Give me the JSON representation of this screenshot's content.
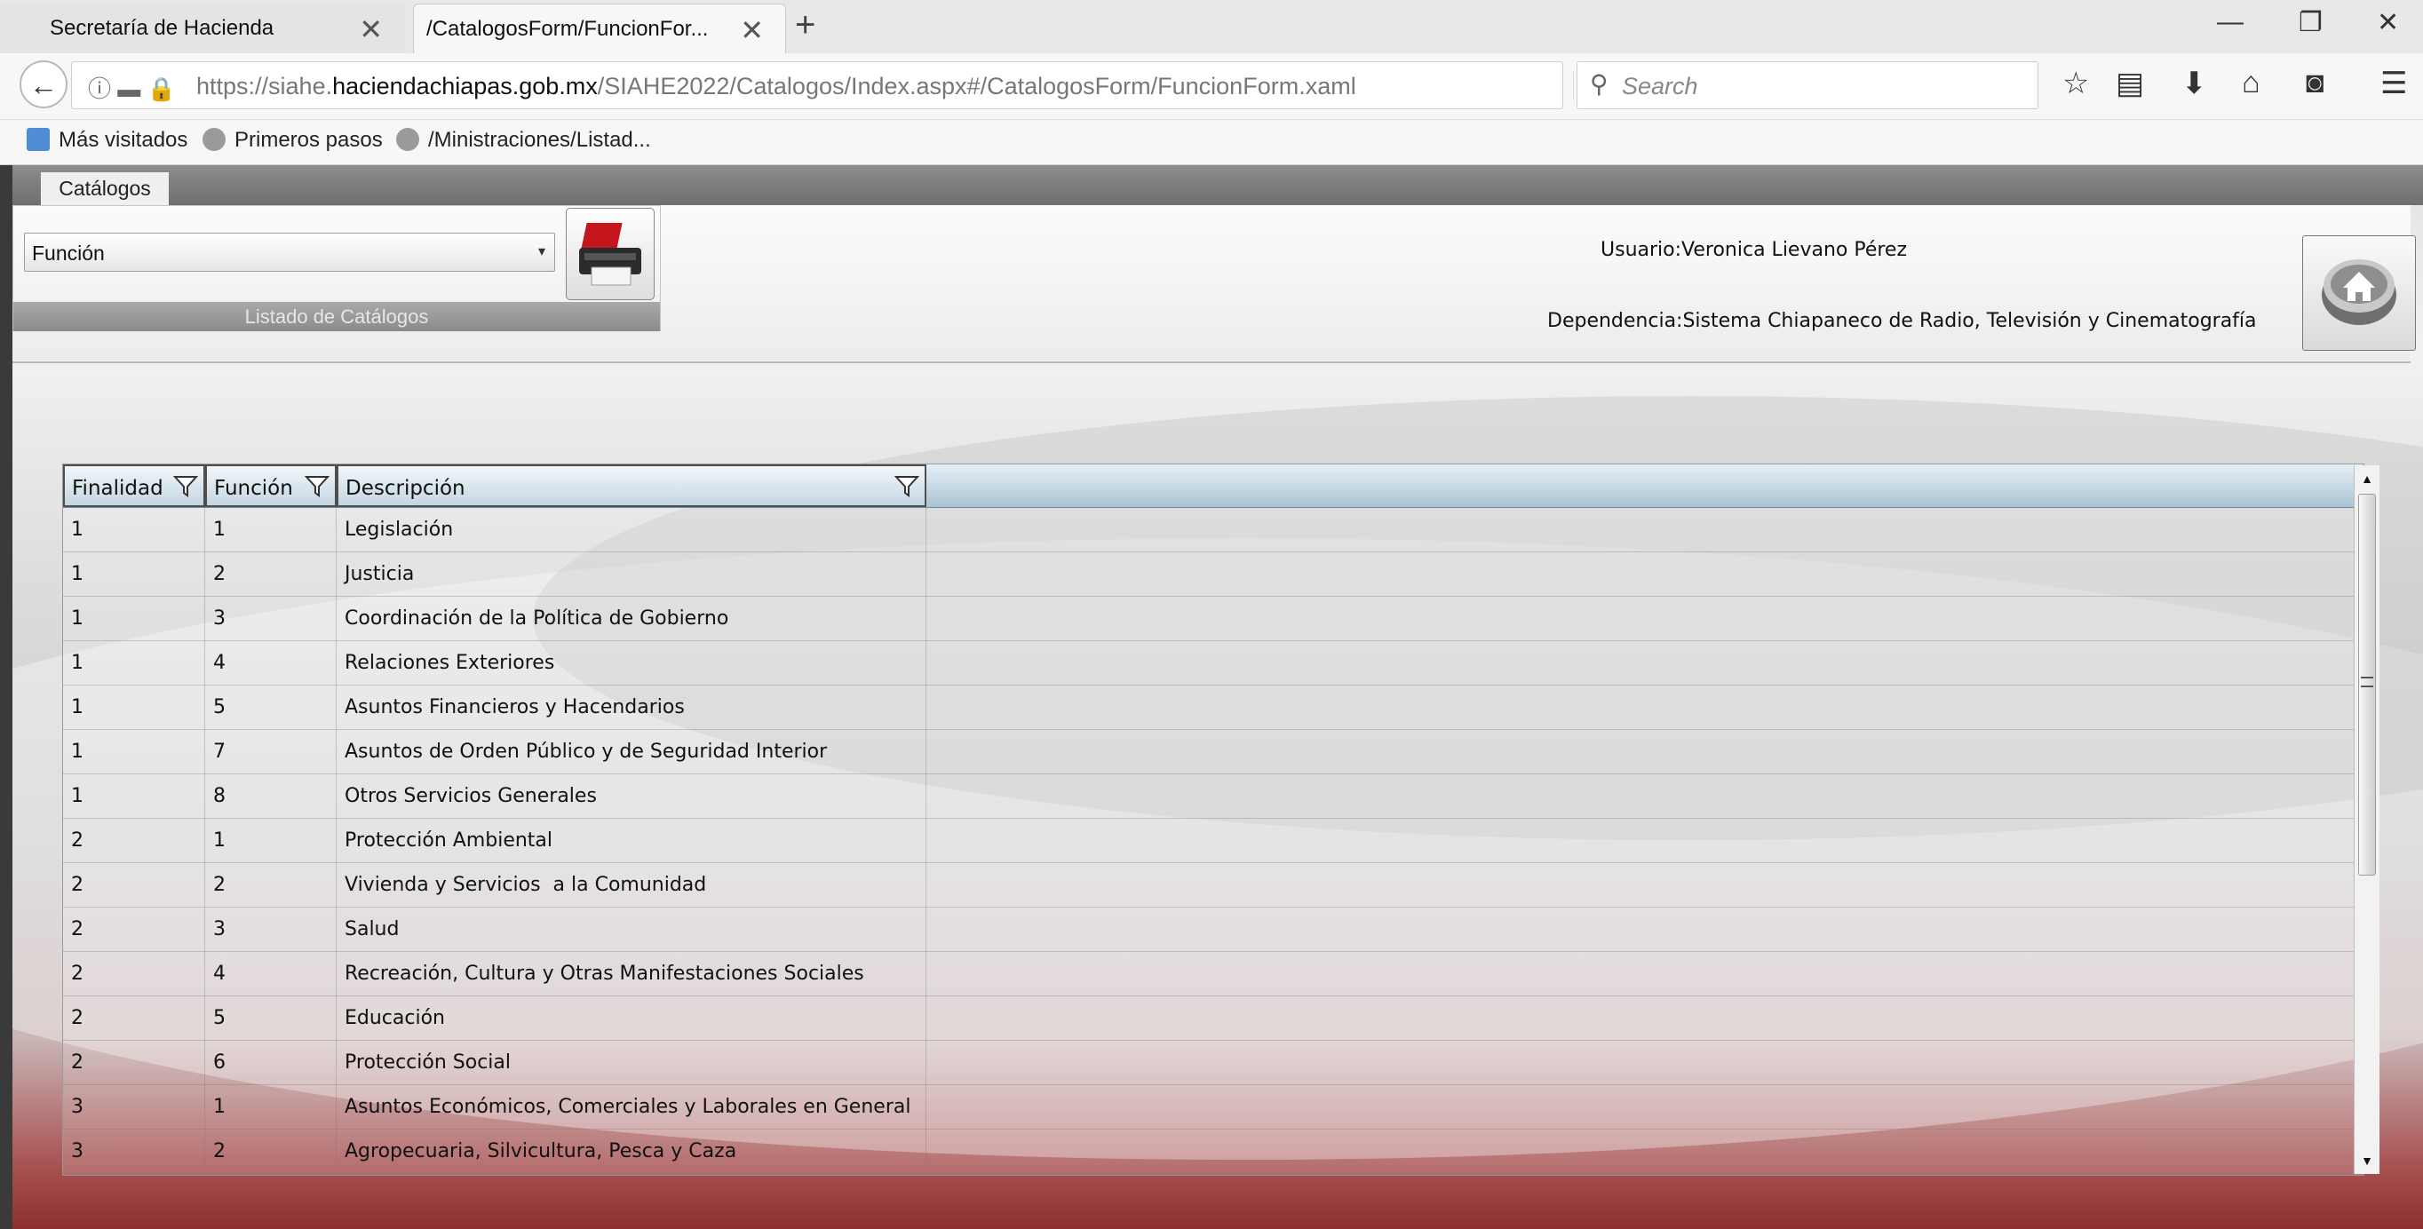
{
  "browser": {
    "tabs": [
      {
        "label": "Secretaría de Hacienda"
      },
      {
        "label": "/CatalogosForm/FuncionFor..."
      }
    ],
    "url_prefix": "https://siahe.",
    "url_domain": "haciendachiapas.gob.mx",
    "url_path": "/SIAHE2022/Catalogos/Index.aspx#/CatalogosForm/FuncionForm.xaml",
    "search_placeholder": "Search",
    "bookmarks": [
      {
        "label": "Más visitados"
      },
      {
        "label": "Primeros pasos"
      },
      {
        "label": "/Ministraciones/Listad..."
      }
    ]
  },
  "app": {
    "tab_label": "Catálogos",
    "catalog_select_value": "Función",
    "group_caption": "Listado de Catálogos",
    "user_label": "Usuario:",
    "user_name": "Veronica Lievano Pérez",
    "dependency_label": "Dependencia:",
    "dependency_name": "Sistema Chiapaneco de Radio, Televisión y Cinematografía"
  },
  "grid": {
    "columns": [
      "Finalidad",
      "Función",
      "Descripción"
    ],
    "rows": [
      {
        "finalidad": "1",
        "funcion": "1",
        "descripcion": "Legislación"
      },
      {
        "finalidad": "1",
        "funcion": "2",
        "descripcion": "Justicia"
      },
      {
        "finalidad": "1",
        "funcion": "3",
        "descripcion": "Coordinación de la Política de Gobierno"
      },
      {
        "finalidad": "1",
        "funcion": "4",
        "descripcion": "Relaciones Exteriores"
      },
      {
        "finalidad": "1",
        "funcion": "5",
        "descripcion": "Asuntos Financieros y Hacendarios"
      },
      {
        "finalidad": "1",
        "funcion": "7",
        "descripcion": "Asuntos de Orden Público y de Seguridad Interior"
      },
      {
        "finalidad": "1",
        "funcion": "8",
        "descripcion": "Otros Servicios Generales"
      },
      {
        "finalidad": "2",
        "funcion": "1",
        "descripcion": "Protección Ambiental"
      },
      {
        "finalidad": "2",
        "funcion": "2",
        "descripcion": "Vivienda y Servicios  a la Comunidad"
      },
      {
        "finalidad": "2",
        "funcion": "3",
        "descripcion": "Salud"
      },
      {
        "finalidad": "2",
        "funcion": "4",
        "descripcion": "Recreación, Cultura y Otras Manifestaciones Sociales"
      },
      {
        "finalidad": "2",
        "funcion": "5",
        "descripcion": "Educación"
      },
      {
        "finalidad": "2",
        "funcion": "6",
        "descripcion": "Protección Social"
      },
      {
        "finalidad": "3",
        "funcion": "1",
        "descripcion": "Asuntos Económicos, Comerciales y Laborales en General"
      },
      {
        "finalidad": "3",
        "funcion": "2",
        "descripcion": "Agropecuaria, Silvicultura, Pesca y Caza"
      }
    ]
  },
  "icons": [
    "back-arrow-icon",
    "info-icon",
    "lock-warning-icon",
    "reload-icon",
    "search-icon",
    "star-icon",
    "reading-list-icon",
    "download-icon",
    "home-icon",
    "pocket-icon",
    "menu-icon",
    "printer-icon",
    "filter-icon"
  ]
}
